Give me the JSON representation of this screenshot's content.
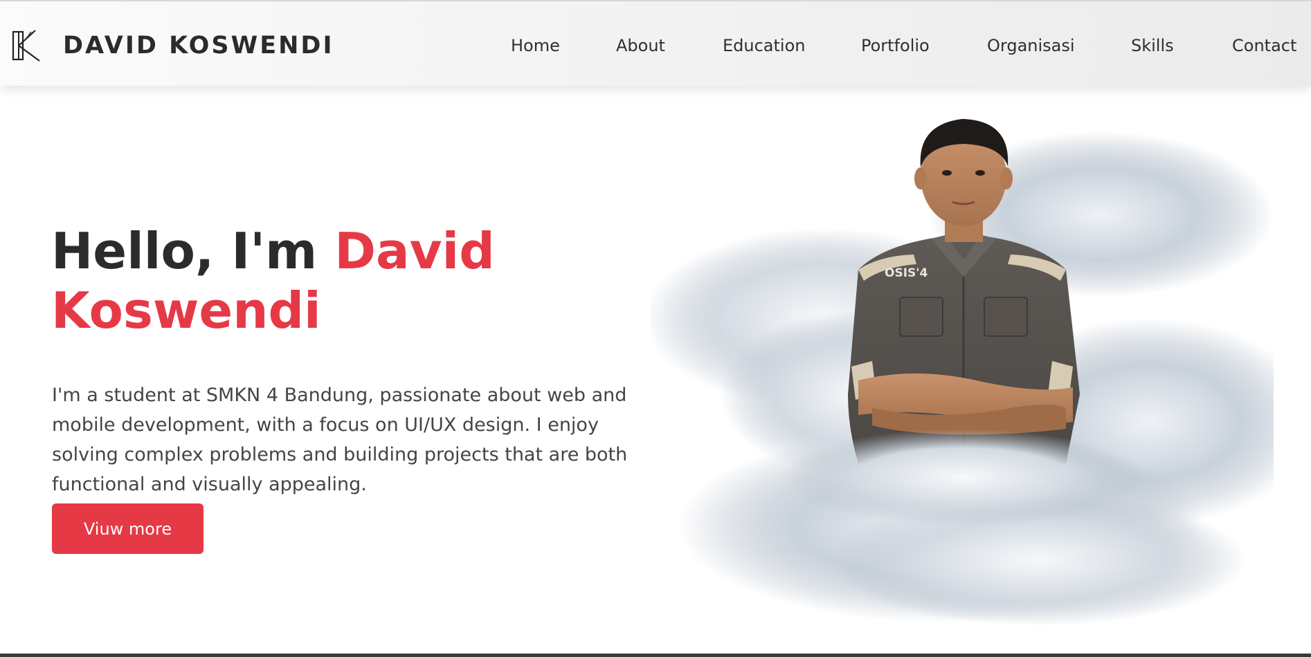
{
  "header": {
    "brand": "DAVID KOSWENDI",
    "logo_icon": "dk-monogram-icon",
    "nav": [
      {
        "label": "Home"
      },
      {
        "label": "About"
      },
      {
        "label": "Education"
      },
      {
        "label": "Portfolio"
      },
      {
        "label": "Organisasi"
      },
      {
        "label": "Skills"
      },
      {
        "label": "Contact"
      }
    ]
  },
  "hero": {
    "greeting": "Hello, I'm",
    "name_first": "David",
    "name_last": "Koswendi",
    "description": "I'm a student at SMKN 4 Bandung, passionate about web and mobile development, with a focus on UI/UX design. I enjoy solving complex problems and building projects that are both functional and visually appealing.",
    "button_label": "Viuw more",
    "shirt_badge": "OSIS'4"
  },
  "colors": {
    "accent": "#e63946",
    "text_dark": "#2b2b2b",
    "navbar_bg": "#f3f3f3"
  }
}
